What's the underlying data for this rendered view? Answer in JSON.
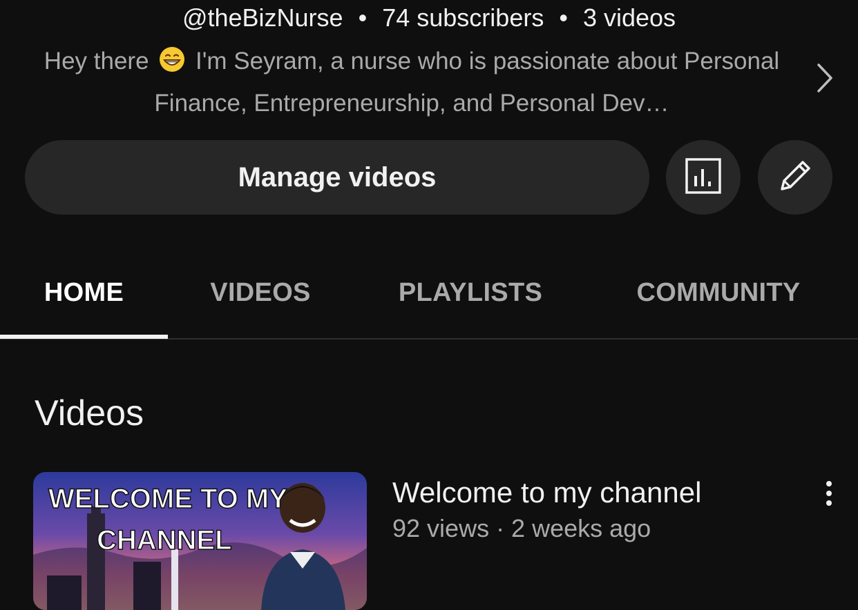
{
  "channel": {
    "handle": "@theBizNurse",
    "separator": "•",
    "subscribers": "74 subscribers",
    "video_count": "3 videos",
    "description_start": "Hey there",
    "description_end": "I'm Seyram, a nurse who is passionate about Personal Finance, Entrepreneurship, and Personal Dev…",
    "description_emoji": "grinning-face-icon"
  },
  "actions": {
    "manage_label": "Manage videos",
    "analytics_icon": "analytics-icon",
    "edit_icon": "pencil-icon"
  },
  "tabs": [
    {
      "label": "HOME",
      "active": true
    },
    {
      "label": "VIDEOS",
      "active": false
    },
    {
      "label": "PLAYLISTS",
      "active": false
    },
    {
      "label": "COMMUNITY",
      "active": false
    }
  ],
  "section": {
    "title": "Videos"
  },
  "videos": [
    {
      "title": "Welcome to my channel",
      "meta": "92 views · 2 weeks ago",
      "thumbnail_text_line1": "WELCOME TO MY",
      "thumbnail_text_line2": "CHANNEL"
    }
  ],
  "colors": {
    "background": "#0f0f0f",
    "button": "#272727",
    "text_primary": "#f1f1f1",
    "text_secondary": "#aaaaaa"
  }
}
